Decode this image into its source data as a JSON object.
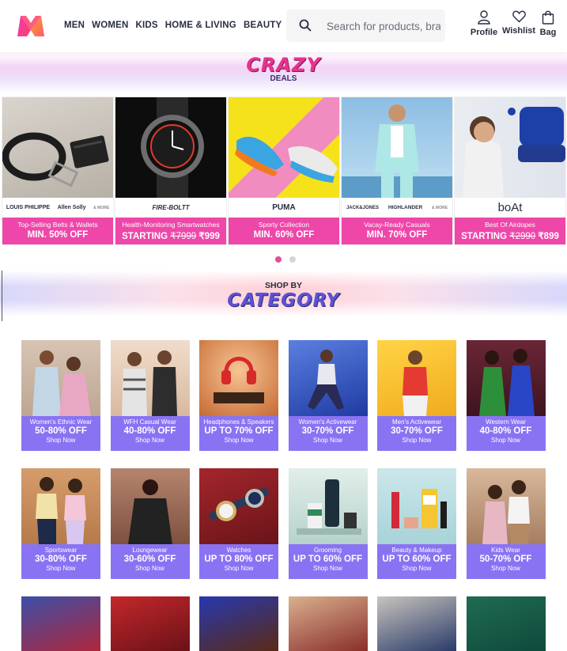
{
  "header": {
    "nav": [
      "MEN",
      "WOMEN",
      "KIDS",
      "HOME & LIVING",
      "BEAUTY"
    ],
    "search_placeholder": "Search for products, brands and more",
    "actions": [
      "Profile",
      "Wishlist",
      "Bag"
    ]
  },
  "crazy_deals": {
    "title": "CRAZY",
    "subtitle": "DEALS",
    "items": [
      {
        "brands": [
          "LOUIS PHILIPPE",
          "Allen Solly",
          "& MORE"
        ],
        "caption": "Top-Selling Belts & Wallets",
        "offer": "MIN. 50% OFF"
      },
      {
        "brands": [
          "FIRE-BOLTT"
        ],
        "caption": "Health-Monitoring Smartwatches",
        "offer_prefix": "STARTING ",
        "old_price": "₹7999",
        "new_price": " ₹999"
      },
      {
        "brands": [
          "PUMA"
        ],
        "caption": "Sporty Collection",
        "offer": "MIN. 60% OFF"
      },
      {
        "brands": [
          "JACK&JONES",
          "HIGHLANDER",
          "& MORE"
        ],
        "caption": "Vacay-Ready Casuals",
        "offer": "MIN. 70% OFF"
      },
      {
        "brands": [
          "boAt"
        ],
        "caption": "Best Of Airdopes",
        "offer_prefix": "STARTING ",
        "old_price": "₹2990",
        "new_price": " ₹899"
      }
    ]
  },
  "category": {
    "title_small": "SHOP BY",
    "title_big": "CATEGORY",
    "items": [
      {
        "name": "Women's Ethnic Wear",
        "offer": "50-80% OFF",
        "cta": "Shop Now",
        "bg": "#c9b2a0"
      },
      {
        "name": "WFH Casual Wear",
        "offer": "40-80% OFF",
        "cta": "Shop Now",
        "bg": "#e6c9b3"
      },
      {
        "name": "Headphones & Speakers",
        "offer": "UP TO 70% OFF",
        "cta": "Shop Now",
        "bg": "#f0a16a"
      },
      {
        "name": "Women's Activewear",
        "offer": "30-70% OFF",
        "cta": "Shop Now",
        "bg": "#3a5bc8"
      },
      {
        "name": "Men's Activewear",
        "offer": "30-70% OFF",
        "cta": "Shop Now",
        "bg": "#f1c23d"
      },
      {
        "name": "Western Wear",
        "offer": "40-80% OFF",
        "cta": "Shop Now",
        "bg": "#5a1f2e"
      },
      {
        "name": "Sportswear",
        "offer": "30-80% OFF",
        "cta": "Shop Now",
        "bg": "#c98b5a"
      },
      {
        "name": "Loungewear",
        "offer": "30-60% OFF",
        "cta": "Shop Now",
        "bg": "#a3705a"
      },
      {
        "name": "Watches",
        "offer": "UP TO 80% OFF",
        "cta": "Shop Now",
        "bg": "#8f2228"
      },
      {
        "name": "Grooming",
        "offer": "UP TO 60% OFF",
        "cta": "Shop Now",
        "bg": "#cde2dd"
      },
      {
        "name": "Beauty & Makeup",
        "offer": "UP TO 60% OFF",
        "cta": "Shop Now",
        "bg": "#bfe0e4"
      },
      {
        "name": "Kids Wear",
        "offer": "50-70% OFF",
        "cta": "Shop Now",
        "bg": "#c6a48a"
      }
    ]
  },
  "colors": {
    "deal_strip": "#ee47a9",
    "category_label": "#8a73f3",
    "dot_active": "#e64b9e"
  }
}
